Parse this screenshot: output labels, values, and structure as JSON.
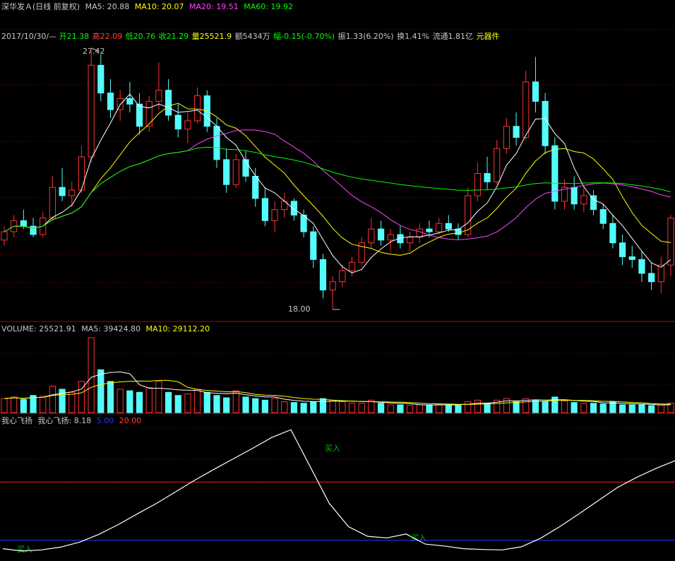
{
  "header": {
    "title": "深华发Ａ(日线 前复权)",
    "ma5": "MA5: 20.88",
    "ma10": "MA10: 20.07",
    "ma20": "MA20: 19.51",
    "ma60": "MA60: 19.92"
  },
  "quote": {
    "date": "2017/10/30/—",
    "open": "开21.38",
    "high": "高22.09",
    "low": "低20.76",
    "close": "收21.29",
    "volume": "量25521.9",
    "amount": "额5434万",
    "change": "幅-0.15(-0.70%)",
    "amplitude": "振1.33(6.20%)",
    "turnover": "换1.41%",
    "float": "流通1.81亿",
    "sector": "元器件"
  },
  "price_labels": {
    "max": "27.42",
    "min": "18.00"
  },
  "volume_header": {
    "volume": "VOLUME: 25521.91",
    "ma5": "MA5: 39424.80",
    "ma10": "MA10: 29112.20"
  },
  "indicator_header": {
    "name": "我心飞扬",
    "value": "我心飞扬: 8.18",
    "level_low": "5.00",
    "level_high": "20.00"
  },
  "signals": {
    "buy1": "买入",
    "buy2": "买入",
    "buy3": "买入"
  },
  "colors": {
    "up": "#ff3232",
    "down": "#54fcfc",
    "ma5": "#ffffff",
    "ma10": "#ffff00",
    "ma20": "#ff44ff",
    "ma60": "#00ff00",
    "grid": "#8b0000",
    "level_low": "#3030ff",
    "level_high": "#ff2020"
  },
  "chart_data": [
    {
      "type": "candlestick",
      "series_names": [
        "MA5",
        "MA10",
        "MA20",
        "MA60"
      ],
      "ylim": [
        18.0,
        27.42
      ],
      "max_price": 27.42,
      "min_price": 18.0,
      "ohlc": [
        [
          20.5,
          21.0,
          20.3,
          20.8
        ],
        [
          20.8,
          21.4,
          20.6,
          21.2
        ],
        [
          21.2,
          21.6,
          20.9,
          21.0
        ],
        [
          21.0,
          21.3,
          20.6,
          20.7
        ],
        [
          20.7,
          21.5,
          20.6,
          21.3
        ],
        [
          21.3,
          22.8,
          21.2,
          22.4
        ],
        [
          22.4,
          23.1,
          21.9,
          22.1
        ],
        [
          22.1,
          22.6,
          21.7,
          22.3
        ],
        [
          22.3,
          23.9,
          22.2,
          23.5
        ],
        [
          23.5,
          27.42,
          23.3,
          26.8
        ],
        [
          26.8,
          27.2,
          25.5,
          25.8
        ],
        [
          25.8,
          26.3,
          24.9,
          25.2
        ],
        [
          25.2,
          25.9,
          24.8,
          25.6
        ],
        [
          25.6,
          26.2,
          25.1,
          25.4
        ],
        [
          25.4,
          25.8,
          24.3,
          24.6
        ],
        [
          24.6,
          25.7,
          24.4,
          25.5
        ],
        [
          25.5,
          26.9,
          25.2,
          25.9
        ],
        [
          25.9,
          26.3,
          24.8,
          25.0
        ],
        [
          25.0,
          25.4,
          24.2,
          24.5
        ],
        [
          24.5,
          25.1,
          24.0,
          24.8
        ],
        [
          24.8,
          26.0,
          24.7,
          25.7
        ],
        [
          25.7,
          25.9,
          24.4,
          24.6
        ],
        [
          24.6,
          24.9,
          23.1,
          23.4
        ],
        [
          23.4,
          23.8,
          22.2,
          22.5
        ],
        [
          22.5,
          23.6,
          22.4,
          23.4
        ],
        [
          23.4,
          23.7,
          22.6,
          22.8
        ],
        [
          22.8,
          23.1,
          21.7,
          22.0
        ],
        [
          22.0,
          22.4,
          21.0,
          21.2
        ],
        [
          21.2,
          21.9,
          20.8,
          21.6
        ],
        [
          21.6,
          22.2,
          21.3,
          21.9
        ],
        [
          21.9,
          22.0,
          21.2,
          21.4
        ],
        [
          21.4,
          21.6,
          20.6,
          20.8
        ],
        [
          20.8,
          21.0,
          19.5,
          19.8
        ],
        [
          19.8,
          20.0,
          18.4,
          18.7
        ],
        [
          18.7,
          19.2,
          18.0,
          19.0
        ],
        [
          19.0,
          19.6,
          18.8,
          19.4
        ],
        [
          19.4,
          19.9,
          19.2,
          19.7
        ],
        [
          19.7,
          20.6,
          19.6,
          20.4
        ],
        [
          20.4,
          21.3,
          20.2,
          20.9
        ],
        [
          20.9,
          21.2,
          20.3,
          20.5
        ],
        [
          20.5,
          20.9,
          20.1,
          20.7
        ],
        [
          20.7,
          21.0,
          20.2,
          20.4
        ],
        [
          20.4,
          20.8,
          20.1,
          20.6
        ],
        [
          20.6,
          21.1,
          20.4,
          20.9
        ],
        [
          20.9,
          21.2,
          20.6,
          20.8
        ],
        [
          20.8,
          21.3,
          20.7,
          21.1
        ],
        [
          21.1,
          21.4,
          20.8,
          20.9
        ],
        [
          20.9,
          21.1,
          20.5,
          20.7
        ],
        [
          20.7,
          22.4,
          20.6,
          22.1
        ],
        [
          22.1,
          23.3,
          21.9,
          22.9
        ],
        [
          22.9,
          23.5,
          22.3,
          22.6
        ],
        [
          22.6,
          24.1,
          22.5,
          23.8
        ],
        [
          23.8,
          24.9,
          23.6,
          24.6
        ],
        [
          24.6,
          25.1,
          23.9,
          24.2
        ],
        [
          24.2,
          26.6,
          24.1,
          26.2
        ],
        [
          26.2,
          27.1,
          25.1,
          25.5
        ],
        [
          25.5,
          25.8,
          23.6,
          23.9
        ],
        [
          23.9,
          24.2,
          21.6,
          21.9
        ],
        [
          21.9,
          22.7,
          21.6,
          22.4
        ],
        [
          22.4,
          22.8,
          21.6,
          21.8
        ],
        [
          21.8,
          22.4,
          21.5,
          22.1
        ],
        [
          22.1,
          22.3,
          21.4,
          21.6
        ],
        [
          21.6,
          21.8,
          20.9,
          21.1
        ],
        [
          21.1,
          21.4,
          20.2,
          20.4
        ],
        [
          20.4,
          20.7,
          19.6,
          19.9
        ],
        [
          19.9,
          20.3,
          19.5,
          19.8
        ],
        [
          19.8,
          20.1,
          19.0,
          19.3
        ],
        [
          19.3,
          19.7,
          18.7,
          19.0
        ],
        [
          19.0,
          19.9,
          18.6,
          19.6
        ],
        [
          19.6,
          21.4,
          19.2,
          21.29
        ]
      ]
    },
    {
      "type": "bar",
      "name": "VOLUME",
      "series_names": [
        "MA5",
        "MA10"
      ],
      "values": [
        18,
        20,
        17,
        22,
        21,
        34,
        30,
        26,
        40,
        96,
        55,
        40,
        30,
        28,
        26,
        32,
        40,
        26,
        22,
        24,
        30,
        26,
        22,
        19,
        28,
        20,
        18,
        16,
        18,
        14,
        13,
        12,
        14,
        18,
        16,
        14,
        12,
        12,
        16,
        12,
        10,
        10,
        9,
        10,
        10,
        11,
        10,
        9,
        14,
        16,
        12,
        16,
        18,
        14,
        18,
        16,
        14,
        20,
        15,
        13,
        12,
        12,
        11,
        14,
        10,
        10,
        10,
        9,
        10,
        12
      ]
    },
    {
      "type": "line",
      "name": "我心飞扬",
      "ylim": [
        0,
        35
      ],
      "levels": [
        5.0,
        20.0
      ],
      "values": [
        2.8,
        2.2,
        2.5,
        3.2,
        4.5,
        6.5,
        9.0,
        11.8,
        14.5,
        17.5,
        20.5,
        23.3,
        26.0,
        28.7,
        31.5,
        33.5,
        24.0,
        14.5,
        8.5,
        6.0,
        5.6,
        6.6,
        4.0,
        3.5,
        2.8,
        2.6,
        2.5,
        3.3,
        5.5,
        8.5,
        11.8,
        15.2,
        18.6,
        21.2,
        23.5,
        25.5
      ]
    }
  ]
}
